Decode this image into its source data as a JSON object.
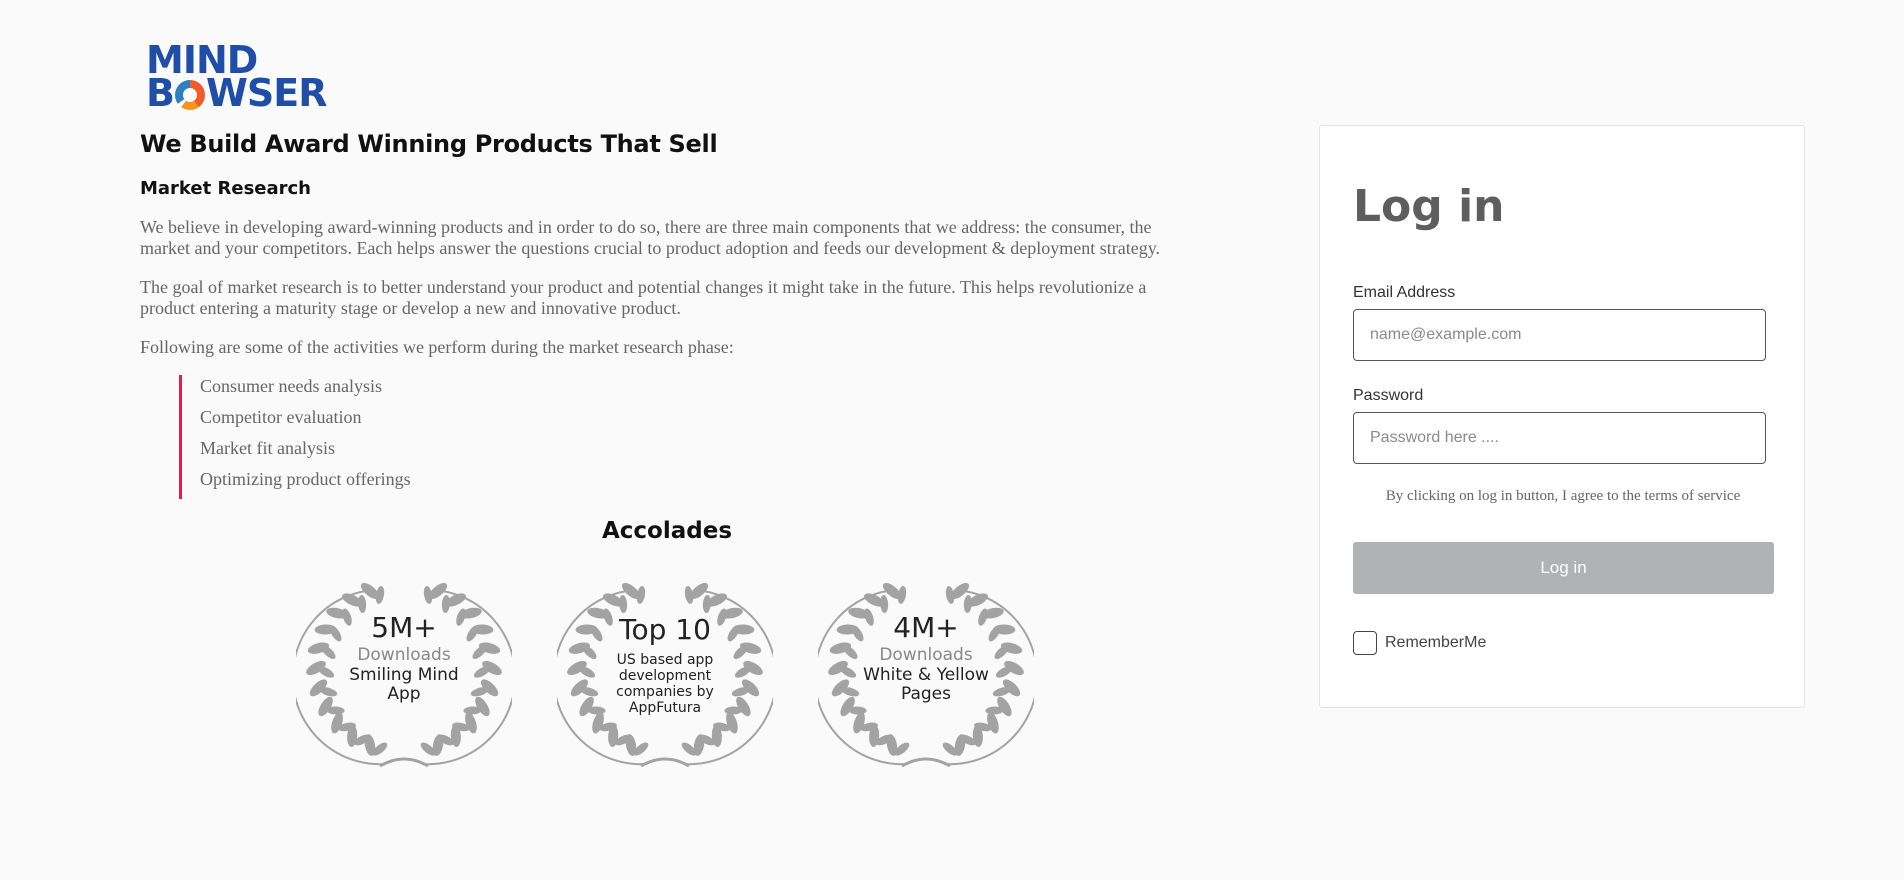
{
  "brand": {
    "logo_line1": "MIND",
    "logo_line2_pre": "B",
    "logo_line2_post": "WSER"
  },
  "intro": {
    "headline": "We Build Award Winning Products That Sell",
    "section_title": "Market Research",
    "paragraphs": [
      "We believe in developing award-winning products and in order to do so, there are three main components that we address: the consumer, the market and your competitors. Each helps answer the questions crucial to product adoption and feeds our development & deployment strategy.",
      "The goal of market research is to better understand your product and potential changes it might take in the future. This helps revolutionize a product entering a maturity stage or develop a new and innovative product.",
      "Following are some of the activities we perform during the market research phase:"
    ],
    "activities": [
      "Consumer needs analysis",
      "Competitor evaluation",
      "Market fit analysis",
      "Optimizing product offerings"
    ]
  },
  "accolades": {
    "title": "Accolades",
    "badges": [
      {
        "headline": "5M+",
        "sub": "Downloads",
        "desc": "Smiling Mind App"
      },
      {
        "headline": "Top 10",
        "sub": "",
        "desc": "US based app development companies by AppFutura"
      },
      {
        "headline": "4M+",
        "sub": "Downloads",
        "desc": "White & Yellow Pages"
      }
    ]
  },
  "login": {
    "title": "Log in",
    "email_label": "Email Address",
    "email_placeholder": "name@example.com",
    "password_label": "Password",
    "password_placeholder": "Password here ....",
    "terms": "By clicking on log in button, I agree to the terms of service",
    "button_label": "Log in",
    "remember_label": "RememberMe"
  },
  "colors": {
    "brand_blue": "#1f4ea8",
    "accent_red": "#e41e49",
    "button_gray": "#b0b2b4"
  }
}
